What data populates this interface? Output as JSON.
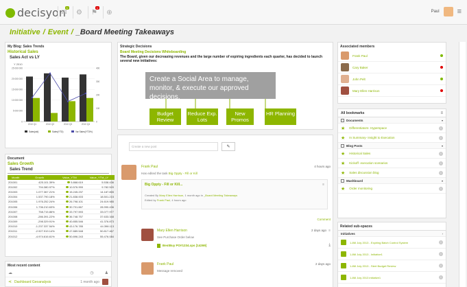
{
  "topbar": {
    "logo_text": "decisyon",
    "badge_1": "1",
    "badge_2": "1",
    "user_name": "Paul"
  },
  "breadcrumb": {
    "part1": "Initiative",
    "part2": "Event",
    "current": "_Board Meeting Takeaways"
  },
  "blog": {
    "panel_title": "My Blog: Sales Trends",
    "section_title": "Historical Sales",
    "chart_title": "Sales Act vs LY"
  },
  "chart_data": {
    "type": "bar",
    "title": "Sales Act vs LY",
    "categories": [
      "2010 Q1",
      "2010 Q2",
      "2010 Q3",
      "2010 Q4"
    ],
    "series": [
      {
        "name": "Sales(ctd)",
        "values": [
          21000000,
          22500000,
          20500000,
          22000000
        ]
      },
      {
        "name": "Sales(YTD)",
        "values": [
          11000000,
          4000000,
          9500000,
          11000000
        ]
      },
      {
        "name": "Var Sales(YTD%)",
        "values": [
          180,
          360,
          150,
          210
        ]
      }
    ],
    "ylim": [
      0,
      25000000
    ],
    "y2lim": [
      0,
      400
    ],
    "yticks": [
      "0",
      "5 000 000",
      "10 000 000",
      "15 000 000",
      "20 000 000",
      "25 000 000"
    ],
    "y2ticks": [
      "0",
      "100",
      "200",
      "300",
      "400"
    ],
    "ylabel_top": "Y 2010"
  },
  "document": {
    "panel_title": "Document",
    "section_title": "Sales Growth",
    "sub_title": "Sales Trend",
    "columns": [
      "Month",
      "Growth",
      "Value_YTM",
      "Value_YTM_LY"
    ],
    "rows": [
      [
        "201001",
        "425.101.39%",
        "5.868.619",
        "5.538.436"
      ],
      [
        "201002",
        "794.380.97%",
        "10.576.999",
        "9.782.520"
      ],
      [
        "201003",
        "1.077.367.21%",
        "15.245.237",
        "14.187.855"
      ],
      [
        "201004",
        "1.537.790.18%",
        "21.838.003",
        "18.501.215"
      ],
      [
        "201005",
        "1.976.252.24%",
        "26.798.101",
        "24.619.985"
      ],
      [
        "201006",
        "1.736.210.63%",
        "30.701.667",
        "28.990.436"
      ],
      [
        "201007",
        "758.715.86%",
        "33.797.593",
        "33.077.977"
      ],
      [
        "201008",
        "-286.391.22%",
        "36.748.757",
        "37.633.348"
      ],
      [
        "201009",
        "-298.329.91%",
        "40.855.546",
        "41.376.873"
      ],
      [
        "201010",
        "-1.237.337.54%",
        "43.176.785",
        "44.398.113"
      ],
      [
        "201011",
        "-2.927.919.14%",
        "47.889.548",
        "50.817.467"
      ],
      [
        "201012",
        "-4.974.616.61%",
        "50.896.243",
        "55.476.084"
      ]
    ]
  },
  "recent": {
    "panel_title": "Most recent content",
    "item_label": "Dashboard Geoanalysis",
    "item_time": "1 month ago"
  },
  "strategic": {
    "panel_title": "Strategic Decisions",
    "section_title": "Board Meeting Decisions Whiteboarding",
    "statement": "The Board, given our decreasing revenues and the large number of expiring ingredients each quarter, has decided to launch several new initiatives:",
    "callout": "Create a Social Area to manage, monitor, & execute our approved decisions.",
    "boxes": [
      "Budget Review",
      "Reduce Exp. Lots",
      "New Promos",
      "HR Planning"
    ]
  },
  "feed": {
    "post_placeholder": "Create a new post",
    "post1": {
      "author": "Frank Paul",
      "time": "4 hours ago",
      "action_prefix": "Has edited the task",
      "action_link": "Big Oppty - Fill or Kill",
      "task_title": "Big Oppty - Fill or Kill...",
      "created_prefix": "Created By",
      "created_by": "Mary Ellen Harrison",
      "created_mid": ", 1 month ago in",
      "created_in": "_Board Meeting Takeaways",
      "edited_prefix": "Edited by",
      "edited_by": "Frank Paul",
      "edited_time": ", 4 hours ago",
      "comment_label": "Comment"
    },
    "post2": {
      "author": "Mary Ellen Harrison",
      "time": "2 days ago",
      "text": "See Purchase Order below",
      "file": "BestBuy PO#1234.xps [14269]"
    },
    "post3": {
      "author": "Frank Paul",
      "time": "2 days ago",
      "text": "Message removed"
    }
  },
  "members": {
    "panel_title": "Associated members",
    "items": [
      {
        "name": "Frank Paul",
        "status": "#7fba00",
        "avatar": "#d99a6c"
      },
      {
        "name": "Cary Baker",
        "status": "#e00000",
        "avatar": "#8a6a4a"
      },
      {
        "name": "John Pelt",
        "status": "#7fba00",
        "avatar": "#e0b090"
      },
      {
        "name": "Mary Ellen Harrison",
        "status": "#e00000",
        "avatar": "#a05040"
      }
    ]
  },
  "bookmarks": {
    "panel_title": "All bookmarks",
    "documents_label": "Documents",
    "items1": [
      "Differentiators- Hyperspace",
      "In Summary- Insight to Execution"
    ],
    "blog_label": "Blog Posts",
    "items2": [
      "Historical Sales",
      "Kickoff- execution scenarios",
      "Sales discussion blog"
    ],
    "mashboard_label": "Mashboard",
    "items3": [
      "Order monitoring"
    ]
  },
  "subspaces": {
    "panel_title": "Related sub-spaces",
    "group_label": "Initiatives",
    "items": [
      "1-8M July 2013 - Expiring Batch Control System",
      "1-8M July 2013 - Initiative1",
      "1-8M July 2013 - Stert Budget Review",
      "1-8M July 2013 initiative1"
    ]
  }
}
